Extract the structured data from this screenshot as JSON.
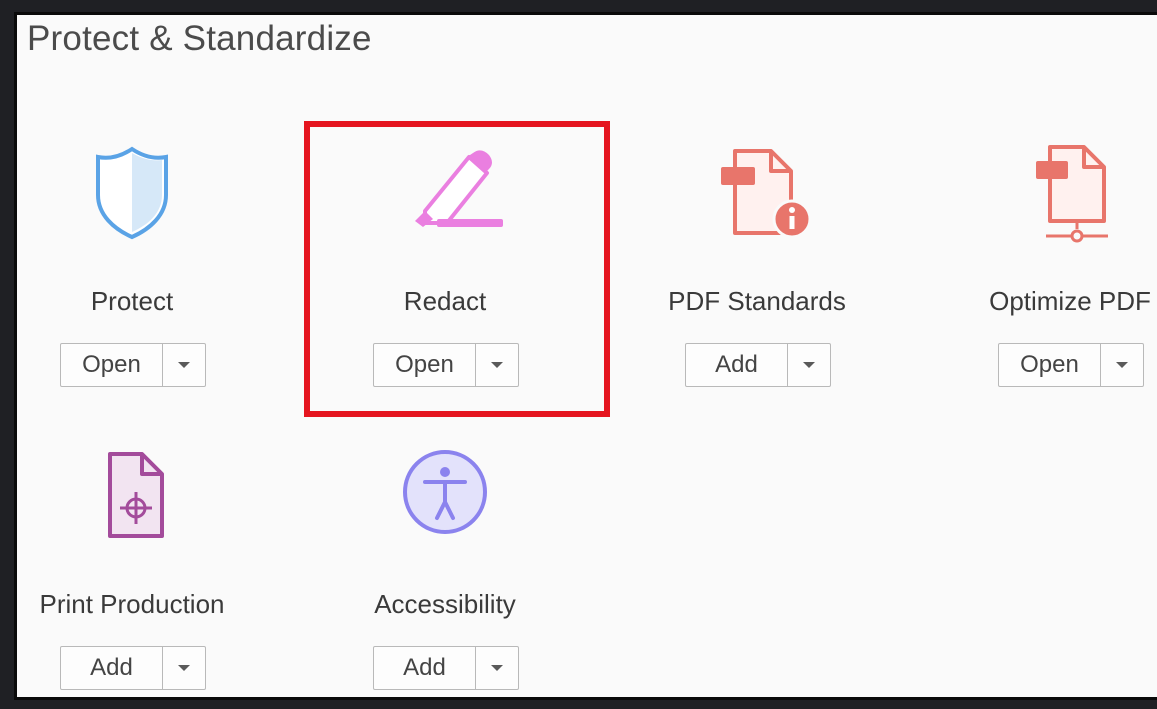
{
  "section": {
    "title": "Protect & Standardize"
  },
  "tools": [
    {
      "label": "Protect",
      "button": "Open",
      "icon": "shield-icon"
    },
    {
      "label": "Redact",
      "button": "Open",
      "icon": "redact-marker-icon"
    },
    {
      "label": "PDF Standards",
      "button": "Add",
      "icon": "pdf-standards-icon"
    },
    {
      "label": "Optimize PDF",
      "button": "Open",
      "icon": "optimize-pdf-icon"
    },
    {
      "label": "Print Production",
      "button": "Add",
      "icon": "print-production-icon"
    },
    {
      "label": "Accessibility",
      "button": "Add",
      "icon": "accessibility-icon"
    }
  ],
  "highlight_color": "#e5151f"
}
